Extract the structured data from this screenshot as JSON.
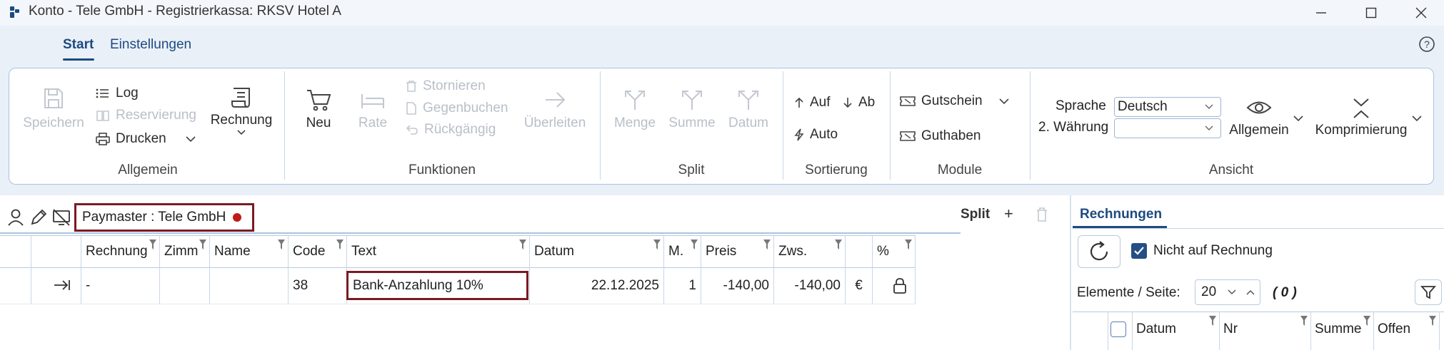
{
  "window": {
    "title": "Konto - Tele GmbH - Registrierkassa: RKSV Hotel A"
  },
  "menu": {
    "tabs": [
      {
        "label": "Start",
        "active": true
      },
      {
        "label": "Einstellungen",
        "active": false
      }
    ]
  },
  "ribbon": {
    "allgemein": {
      "label": "Allgemein",
      "speichern": "Speichern",
      "log": "Log",
      "reservierung": "Reservierung",
      "drucken": "Drucken",
      "rechnung": "Rechnung"
    },
    "funktionen": {
      "label": "Funktionen",
      "neu": "Neu",
      "rate": "Rate",
      "stornieren": "Stornieren",
      "gegenbuchen": "Gegenbuchen",
      "rueckgaengig": "Rückgängig",
      "ueberleiten": "Überleiten"
    },
    "split": {
      "label": "Split",
      "menge": "Menge",
      "summe": "Summe",
      "datum": "Datum"
    },
    "sortierung": {
      "label": "Sortierung",
      "auf": "Auf",
      "ab": "Ab",
      "auto": "Auto"
    },
    "module": {
      "label": "Module",
      "gutschein": "Gutschein",
      "guthaben": "Guthaben"
    },
    "ansicht": {
      "label": "Ansicht",
      "sprache_label": "Sprache",
      "sprache_value": "Deutsch",
      "waehrung_label": "2. Währung",
      "waehrung_value": "",
      "allgemein": "Allgemein",
      "komprimierung": "Komprimierung"
    }
  },
  "account": {
    "paymaster": "Paymaster :  Tele GmbH",
    "split_label": "Split",
    "add_symbol": "+"
  },
  "grid": {
    "headers": [
      "Rechnung",
      "Zimm",
      "Name",
      "Code",
      "Text",
      "Datum",
      "M.",
      "Preis",
      "Zws.",
      "",
      "%"
    ],
    "rows": [
      {
        "rechnung": "-",
        "zimmer": "",
        "name": "",
        "code": "38",
        "text": "Bank-Anzahlung 10%",
        "datum": "22.12.2025",
        "menge": "1",
        "preis": "-140,00",
        "zws": "-140,00",
        "waehrung": "€"
      }
    ]
  },
  "invoices_panel": {
    "tab": "Rechnungen",
    "nicht_auf_rechnung": "Nicht auf Rechnung",
    "nicht_auf_rechnung_checked": true,
    "elemente_label": "Elemente / Seite:",
    "page_size": "20",
    "count": "( 0 )",
    "headers": [
      "Datum",
      "Nr",
      "Summe",
      "Offen"
    ]
  },
  "colors": {
    "accent": "#1d4a80",
    "highlight_border": "#7b1a22",
    "status_dot": "#c01a1a",
    "ribbon_border": "#a9c3e2"
  }
}
